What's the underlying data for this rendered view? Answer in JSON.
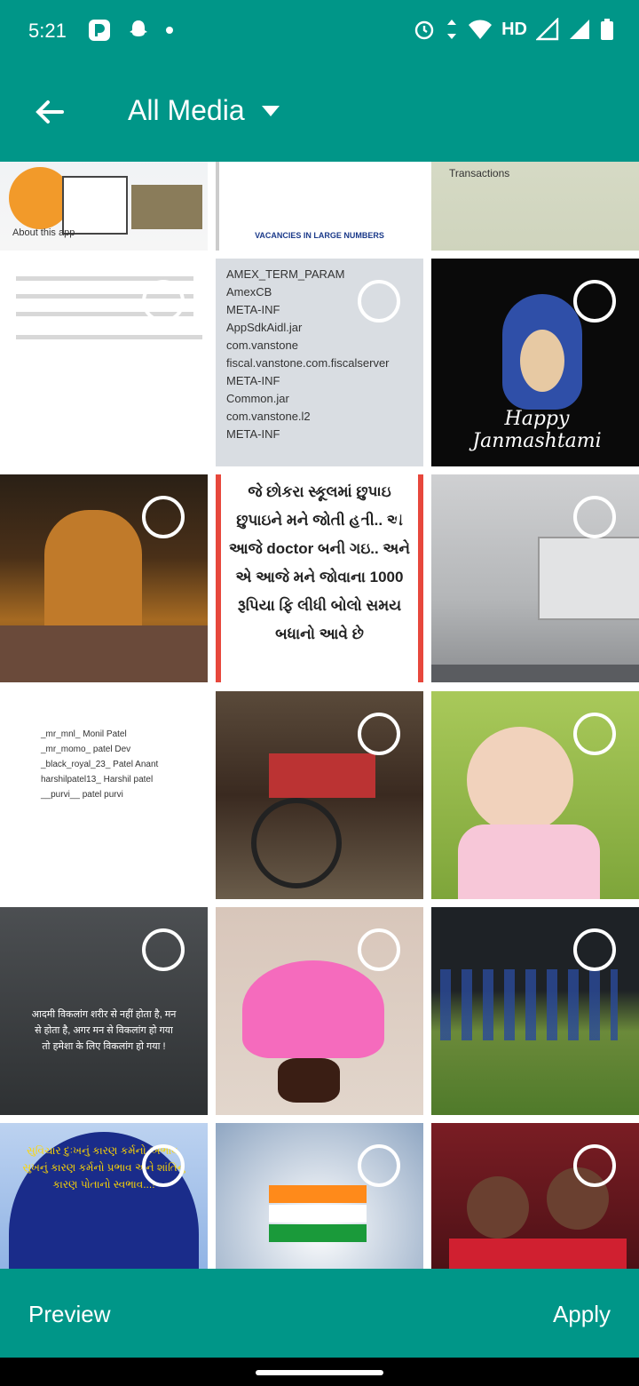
{
  "status_bar": {
    "time": "5:21",
    "network": "HD"
  },
  "header": {
    "title": "All Media"
  },
  "grid": {
    "rows": [
      [
        {
          "label": "About this app"
        },
        {
          "label": "VACANCIES IN LARGE NUMBERS"
        },
        {
          "label": "Transactions"
        }
      ],
      [
        {
          "label": "Gujarati text notice"
        },
        {
          "label": "AMEX_TERM_PARAM\nAmexCB\nMETA-INF\nAppSdkAidl.jar\ncom.vanstone\nfiscal.vanstone.com.fiscalserver\nMETA-INF\nCommon.jar\ncom.vanstone.l2\nMETA-INF"
        },
        {
          "label": "Happy Janmashtami"
        }
      ],
      [
        {
          "label": "Temple procession"
        },
        {
          "label": "જે છોકરા સ્કૂલમાં છુપાઇ છુપાઇને મને જોતી હતી.. એ આજે doctor બની ગઇ.. અને એ આજે મને જોવાના 1000 રૂપિયા ફિ લીધી બોલો સમય બધાનો આવે છે"
        },
        {
          "label": "Empty garage"
        }
      ],
      [
        {
          "label": "_mr_mnl_ Monil Patel\n_mr_momo_ patel Dev\n_black_royal_23_ Patel Anant\nharshilpatel13_ Harshil patel\n__purvi__ patel purvi"
        },
        {
          "label": "Wheelchair"
        },
        {
          "label": "Baby in pink"
        }
      ],
      [
        {
          "label": "आदमी विकलांग शरीर से नहीं होता है, मन से होता है, अगर मन से विकलांग हो गया तो हमेशा के लिए विकलांग हो गया !"
        },
        {
          "label": "Girl in pink dress"
        },
        {
          "label": "Cricket team"
        }
      ],
      [
        {
          "label": "સુવિચાર દુઃખનું કારણ કર્મનો અભાવ, સુખનું કારણ કર્મનો પ્રભાવ અને શાંતિનું કારણ પોતાનો સ્વભાવ...!"
        },
        {
          "label": "India flag art"
        },
        {
          "label": "Two men portrait"
        }
      ]
    ]
  },
  "footer": {
    "preview_label": "Preview",
    "apply_label": "Apply"
  },
  "colors": {
    "primary": "#009688"
  }
}
